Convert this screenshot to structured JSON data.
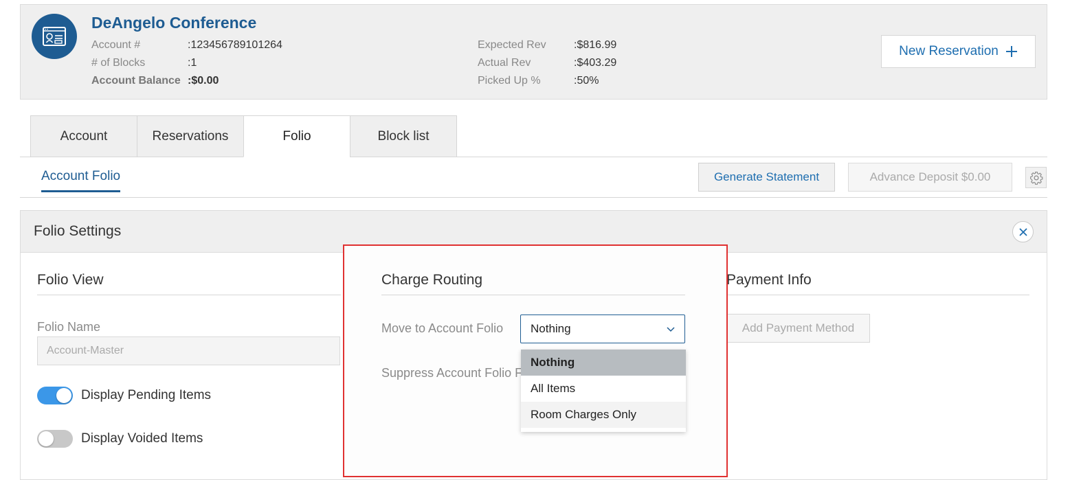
{
  "header": {
    "title": "DeAngelo Conference",
    "left": [
      {
        "label": "Account #",
        "value": ":123456789101264"
      },
      {
        "label": "# of Blocks",
        "value": ":1"
      },
      {
        "label": "Account Balance",
        "value": ":$0.00"
      }
    ],
    "right": [
      {
        "label": "Expected Rev",
        "value": ":$816.99"
      },
      {
        "label": "Actual Rev",
        "value": ":$403.29"
      },
      {
        "label": "Picked Up %",
        "value": ":50%"
      }
    ],
    "new_reservation_label": "New Reservation",
    "new_reservation_icon": "plus-icon"
  },
  "tabs": [
    {
      "label": "Account",
      "active": false
    },
    {
      "label": "Reservations",
      "active": false
    },
    {
      "label": "Folio",
      "active": true
    },
    {
      "label": "Block list",
      "active": false
    }
  ],
  "subtab": {
    "label": "Account Folio"
  },
  "toolbar": {
    "generate_statement": "Generate Statement",
    "advance_deposit": "Advance Deposit $0.00",
    "settings_icon": "gear-icon"
  },
  "folio_settings": {
    "title": "Folio Settings",
    "folio_view": {
      "title": "Folio View",
      "folio_name_label": "Folio Name",
      "folio_name_value": "Account-Master",
      "display_pending_label": "Display Pending Items",
      "display_pending_on": true,
      "display_voided_label": "Display Voided Items",
      "display_voided_on": false
    },
    "charge_routing": {
      "title": "Charge Routing",
      "move_label": "Move to Account Folio",
      "selected": "Nothing",
      "suppress_label": "Suppress Account Folio F",
      "options": [
        "Nothing",
        "All Items",
        "Room Charges Only"
      ]
    },
    "payment_info": {
      "title": "Payment Info",
      "add_payment_label": "Add Payment Method"
    }
  },
  "colors": {
    "brand": "#1e5c92",
    "toggle_on": "#3b97e8",
    "highlight": "#e03131",
    "selected_option": "#b7bcc0"
  }
}
